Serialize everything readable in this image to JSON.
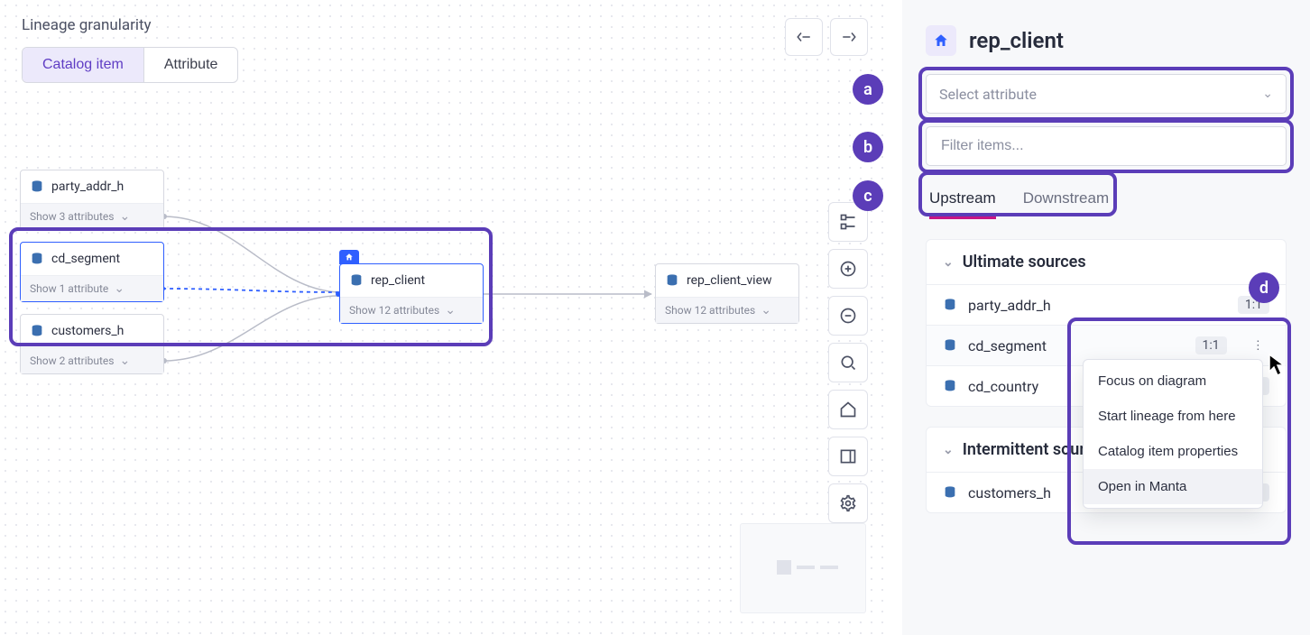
{
  "granularity": {
    "heading": "Lineage granularity",
    "options": {
      "catalog_item": "Catalog item",
      "attribute": "Attribute"
    }
  },
  "canvas_nodes": {
    "party_addr_h": {
      "title": "party_addr_h",
      "foot": "Show 3 attributes"
    },
    "cd_segment": {
      "title": "cd_segment",
      "foot": "Show 1 attribute"
    },
    "customers_h": {
      "title": "customers_h",
      "foot": "Show 2 attributes"
    },
    "rep_client": {
      "title": "rep_client",
      "foot": "Show 12 attributes"
    },
    "rep_client_view": {
      "title": "rep_client_view",
      "foot": "Show 12 attributes"
    }
  },
  "sidebar": {
    "title": "rep_client",
    "select_placeholder": "Select attribute",
    "filter_placeholder": "Filter items...",
    "tabs": {
      "upstream": "Upstream",
      "downstream": "Downstream"
    },
    "groups": {
      "ultimate": {
        "heading": "Ultimate sources",
        "rows": [
          {
            "name": "party_addr_h",
            "badge": "1:1"
          },
          {
            "name": "cd_segment",
            "badge": "1:1"
          },
          {
            "name": "cd_country",
            "badge": "1:1"
          }
        ]
      },
      "intermittent": {
        "heading": "Intermittent sources",
        "rows": [
          {
            "name": "customers_h",
            "badge": "1:1"
          }
        ]
      }
    }
  },
  "context_menu": {
    "focus": "Focus on diagram",
    "start": "Start lineage from here",
    "props": "Catalog item properties",
    "open": "Open in Manta"
  },
  "annotations": {
    "a": "a",
    "b": "b",
    "c": "c",
    "d": "d"
  }
}
